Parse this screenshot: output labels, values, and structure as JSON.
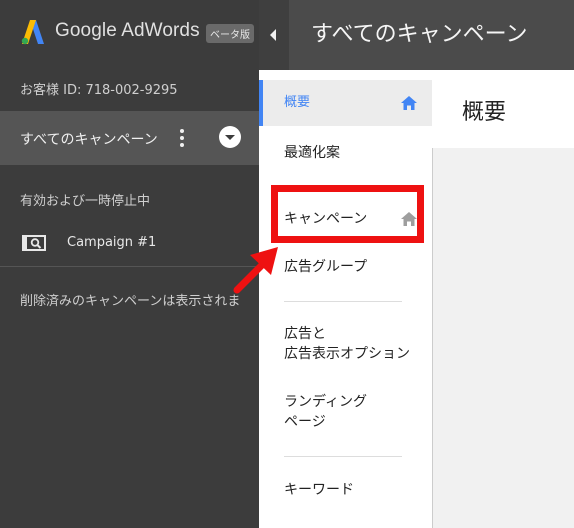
{
  "brand": {
    "name": "Google AdWords",
    "beta_label": "ベータ版"
  },
  "account": {
    "customer_id": "お客様 ID: 718-002-9295"
  },
  "sidebar": {
    "all_campaigns_label": "すべてのキャンペーン",
    "section_label": "有効および一時停止中",
    "campaigns": [
      {
        "name": "Campaign #1"
      }
    ],
    "deleted_note": "削除済みのキャンペーンは表示されま"
  },
  "topbar": {
    "title": "すべてのキャンペーン"
  },
  "nav": {
    "items": [
      {
        "label": "概要"
      },
      {
        "label": "最適化案"
      },
      {
        "label": "キャンペーン"
      },
      {
        "label": "広告グループ"
      },
      {
        "label_line1": "広告と",
        "label_line2": "広告表示オプション"
      },
      {
        "label_line1": "ランディング",
        "label_line2": "ページ"
      },
      {
        "label": "キーワード"
      }
    ]
  },
  "main": {
    "title": "概要"
  },
  "colors": {
    "accent": "#4285f4",
    "highlight": "#ee1111",
    "sidebar_bg": "#3c3c3c",
    "topbar_bg": "#4b4b4b"
  },
  "icons": [
    "adwords-logo-icon",
    "more-vert-icon",
    "dropdown-icon",
    "campaign-search-icon",
    "home-icon",
    "collapse-icon",
    "arrow-annotation"
  ]
}
